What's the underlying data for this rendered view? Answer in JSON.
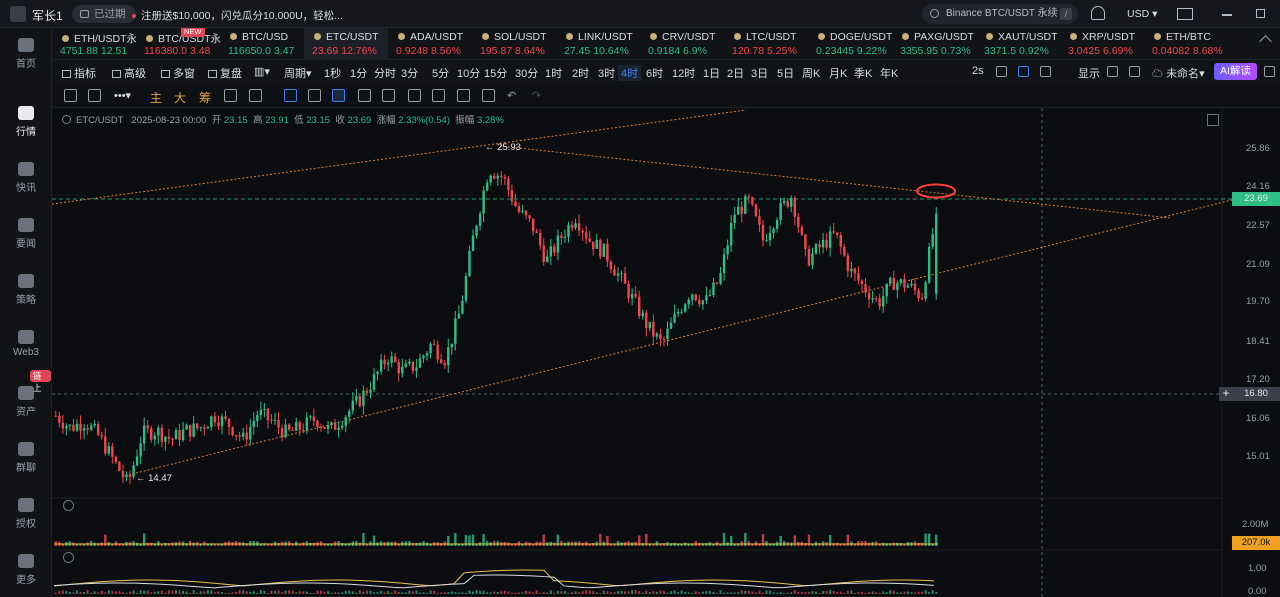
{
  "topbar": {
    "username": "军长1",
    "expired_label": "已过期",
    "promo_text": "注册送$10,000，闪兑瓜分10,000U，轻松...",
    "search_placeholder": "Binance BTC/USDT 永续",
    "search_shortcut": "/",
    "currency": "USD"
  },
  "nav": [
    {
      "label": "首页",
      "icon": "home-icon"
    },
    {
      "label": "行情",
      "icon": "market-icon",
      "active": true
    },
    {
      "label": "快讯",
      "icon": "news-icon"
    },
    {
      "label": "要闻",
      "icon": "headlines-icon"
    },
    {
      "label": "策略",
      "icon": "strategy-icon"
    },
    {
      "label": "Web3",
      "icon": "web3-icon"
    },
    {
      "label": "资产",
      "icon": "wallet-icon",
      "badge": "链上"
    },
    {
      "label": "群聊",
      "icon": "chat-icon"
    },
    {
      "label": "授权",
      "icon": "key-icon"
    },
    {
      "label": "更多",
      "icon": "more-icon"
    }
  ],
  "tickers": [
    {
      "name": "ETH/USDT永",
      "price": "4751.88",
      "change": "12.51",
      "dir": "up"
    },
    {
      "name": "BTC/USDT永",
      "price": "116380.0",
      "change": "3.48",
      "dir": "down",
      "badge": "NEW"
    },
    {
      "name": "BTC/USD",
      "price": "116650.0",
      "change": "3.47",
      "dir": "up"
    },
    {
      "name": "ETC/USDT",
      "price": "23.69",
      "change": "12.76%",
      "dir": "down",
      "active": true
    },
    {
      "name": "ADA/USDT",
      "price": "0.9248",
      "change": "8.56%",
      "dir": "down"
    },
    {
      "name": "SOL/USDT",
      "price": "195.87",
      "change": "8.64%",
      "dir": "down"
    },
    {
      "name": "LINK/USDT",
      "price": "27.45",
      "change": "10.64%",
      "dir": "up"
    },
    {
      "name": "CRV/USDT",
      "price": "0.9184",
      "change": "6.9%",
      "dir": "up"
    },
    {
      "name": "LTC/USDT",
      "price": "120.78",
      "change": "5.25%",
      "dir": "down"
    },
    {
      "name": "DOGE/USDT",
      "price": "0.23445",
      "change": "9.22%",
      "dir": "up"
    },
    {
      "name": "PAXG/USDT",
      "price": "3355.95",
      "change": "0.73%",
      "dir": "up"
    },
    {
      "name": "XAUT/USDT",
      "price": "3371.5",
      "change": "0.92%",
      "dir": "up"
    },
    {
      "name": "XRP/USDT",
      "price": "3.0425",
      "change": "6.69%",
      "dir": "down"
    },
    {
      "name": "ETH/BTC",
      "price": "0.04082",
      "change": "8.68%",
      "dir": "down"
    }
  ],
  "toolbar": {
    "indicators": "指标",
    "advanced": "高级",
    "multi_window": "多窗",
    "replay": "复盘",
    "period": "周期",
    "timeframes": [
      "1秒",
      "1分",
      "分时",
      "3分",
      "5分",
      "10分",
      "15分",
      "30分",
      "1时",
      "2时",
      "3时",
      "4时",
      "6时",
      "12时",
      "1日",
      "2日",
      "3日",
      "5日",
      "周K",
      "月K",
      "季K",
      "年K"
    ],
    "active_timeframe": "4时",
    "refresh": "2s",
    "display": "显示",
    "workspace": "未命名",
    "ai": "AI解读"
  },
  "drawbar": {
    "labels": [
      "主",
      "大",
      "筹"
    ]
  },
  "chart_info": {
    "symbol": "ETC/USDT",
    "datetime": "2025-08-23 00:00",
    "open_label": "开",
    "open": "23.15",
    "high_label": "高",
    "high": "23.91",
    "low_label": "低",
    "low": "23.15",
    "close_label": "收",
    "close": "23.69",
    "change_label": "涨幅",
    "change": "2.33%(0.54)",
    "amp_label": "振幅",
    "amp": "3.28%"
  },
  "price_axis": {
    "ticks": [
      "25.86",
      "24.16",
      "22.57",
      "21.09",
      "19.70",
      "18.41",
      "17.20",
      "16.06",
      "15.01"
    ],
    "current_price": "23.69",
    "crosshair_price": "16.80"
  },
  "annotations": {
    "high_mark": "25.93",
    "low_mark": "14.47"
  },
  "volume_axis": {
    "top": "2.00M",
    "current": "207.0k"
  },
  "osc_axis": {
    "top": "1.00",
    "bottom": "0.00"
  },
  "colors": {
    "up": "#2ebd85",
    "down": "#f0464f",
    "accent": "#3b82f6",
    "trendline": "#e07a3a",
    "highlight_circle": "#ff3b3b"
  },
  "chart_data": {
    "type": "candlestick",
    "interval": "4时",
    "close_path": [
      16.9,
      16.5,
      16.7,
      16.2,
      15.4,
      14.6,
      16.3,
      16.4,
      16.1,
      16.4,
      16.5,
      16.9,
      16.6,
      16.1,
      17.0,
      16.7,
      16.3,
      16.5,
      16.8,
      16.4,
      16.9,
      17.4,
      18.1,
      18.9,
      18.4,
      18.6,
      19.3,
      18.8,
      20.4,
      23.1,
      25.2,
      24.9,
      23.8,
      23.3,
      22.1,
      22.9,
      23.6,
      22.8,
      22.4,
      21.6,
      20.8,
      19.9,
      19.3,
      20.3,
      21.1,
      20.7,
      21.5,
      23.7,
      24.1,
      22.8,
      23.7,
      24.3,
      22.1,
      22.6,
      23.0,
      21.8,
      21.2,
      20.7,
      21.4,
      21.3,
      20.9,
      23.69
    ],
    "price_range": [
      14.47,
      25.93
    ]
  }
}
